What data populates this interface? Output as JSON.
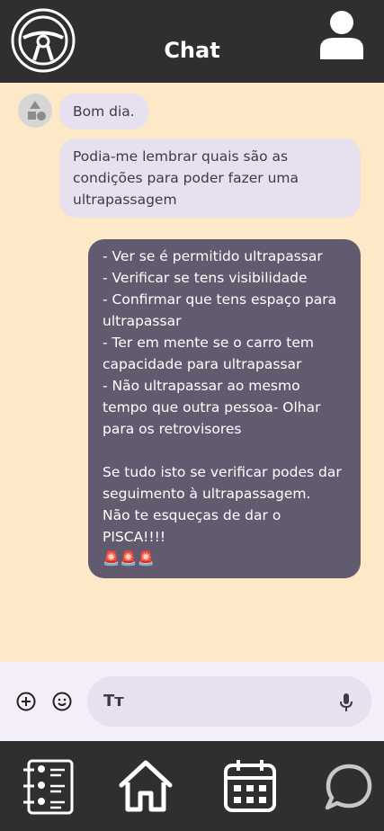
{
  "header": {
    "title": "Chat",
    "logo_icon": "steering-wheel-icon",
    "profile_icon": "user-icon"
  },
  "messages": [
    {
      "from": "other",
      "text": "Bom dia."
    },
    {
      "from": "other",
      "text": "Podia-me lembrar quais são as condições para poder fazer uma ultrapassagem"
    },
    {
      "from": "me",
      "text": "- Ver se é permitido ultrapassar\n- Verificar se tens visibilidade\n- Confirmar que tens espaço para ultrapassar\n- Ter em mente se o carro tem capacidade para ultrapassar\n- Não ultrapassar ao mesmo tempo que outra pessoa- Olhar para os retrovisores\n\nSe tudo isto se verificar podes dar seguimento à ultrapassagem.\nNão te esqueças de dar o PISCA!!!!\n🚨🚨🚨"
    }
  ],
  "composer": {
    "text_format_label": "Tт"
  },
  "nav": {
    "items": [
      "contacts-icon",
      "home-icon",
      "calendar-icon",
      "chat-icon"
    ]
  }
}
